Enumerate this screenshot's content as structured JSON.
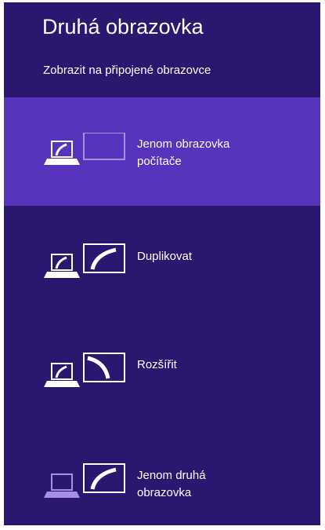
{
  "panel": {
    "title": "Druhá obrazovka",
    "subtitle": "Zobrazit na připojené obrazovce",
    "background_color": "#2a1870",
    "selected_color": "#5734bb"
  },
  "options": [
    {
      "icon": "pc-screen-only-icon",
      "label_line1": "Jenom obrazovka",
      "label_line2": "počítače",
      "selected": true
    },
    {
      "icon": "duplicate-icon",
      "label_line1": "Duplikovat",
      "label_line2": "",
      "selected": false
    },
    {
      "icon": "extend-icon",
      "label_line1": "Rozšířit",
      "label_line2": "",
      "selected": false
    },
    {
      "icon": "second-screen-only-icon",
      "label_line1": "Jenom druhá",
      "label_line2": "obrazovka",
      "selected": false
    }
  ]
}
